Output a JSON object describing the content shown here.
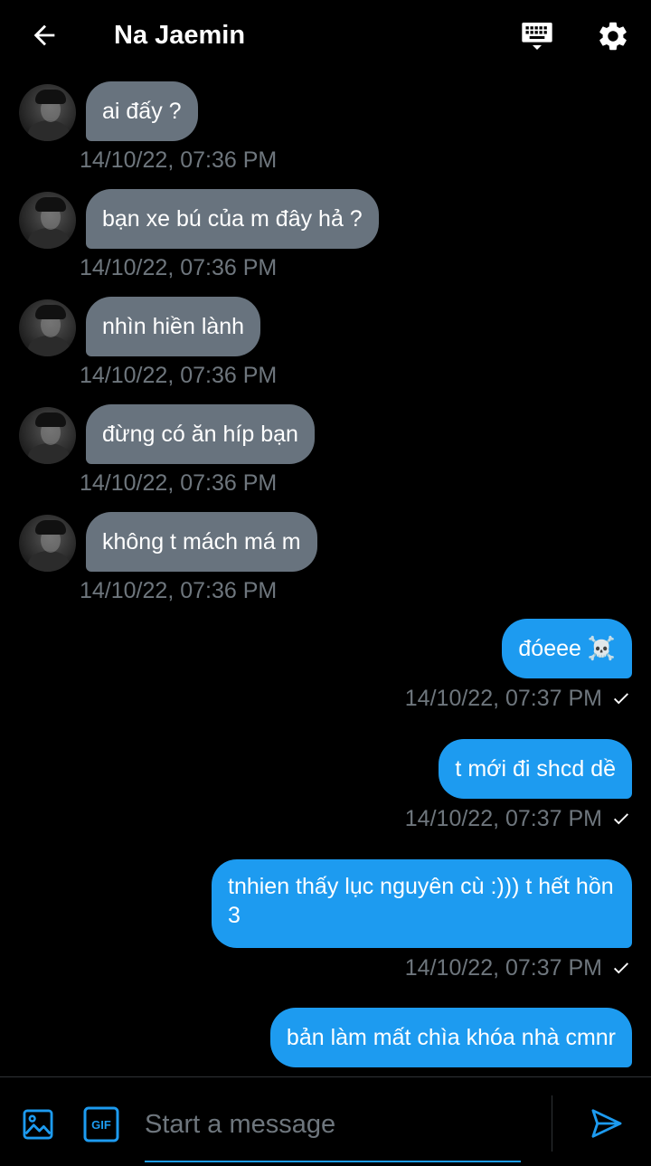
{
  "header": {
    "title": "Na Jaemin"
  },
  "icons": {
    "back": "arrow-left-icon",
    "keyboard": "keyboard-icon",
    "settings": "gear-icon",
    "image": "image-icon",
    "gif": "gif-icon",
    "send": "send-icon",
    "read": "check-icon"
  },
  "colors": {
    "accent": "#1d9bf0",
    "incoming_bubble": "#68737e",
    "timestamp": "#6e767d",
    "background": "#000000"
  },
  "messages": [
    {
      "direction": "in",
      "text": "ai đấy ?",
      "time": "14/10/22, 07:36 PM"
    },
    {
      "direction": "in",
      "text": "bạn xe bú của m đây hả ?",
      "time": "14/10/22, 07:36 PM"
    },
    {
      "direction": "in",
      "text": "nhìn hiền lành",
      "time": "14/10/22, 07:36 PM"
    },
    {
      "direction": "in",
      "text": "đừng có ăn híp bạn",
      "time": "14/10/22, 07:36 PM"
    },
    {
      "direction": "in",
      "text": "không t mách má m",
      "time": "14/10/22, 07:36 PM"
    },
    {
      "direction": "out",
      "text": "đóeee ☠️",
      "time": "14/10/22, 07:37 PM"
    },
    {
      "direction": "out",
      "text": "t mới đi shcd dề",
      "time": "14/10/22, 07:37 PM"
    },
    {
      "direction": "out",
      "text": "tnhien thấy lục nguyên cù :))) t hết hồn 3",
      "time": "14/10/22, 07:37 PM"
    },
    {
      "direction": "out",
      "text": "bản làm mất chìa khóa nhà cmnr"
    }
  ],
  "composer": {
    "placeholder": "Start a message",
    "value": "",
    "gif_label": "GIF"
  }
}
